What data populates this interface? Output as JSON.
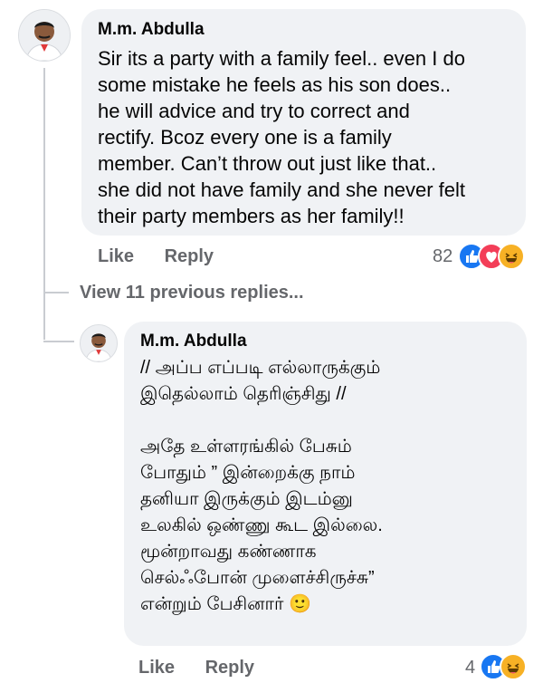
{
  "comments": [
    {
      "author": "M.m. Abdulla",
      "text": "Sir its a party with a family feel.. even I do\nsome mistake he feels  as his son does..\nhe will advice and try to correct and\nrectify. Bcoz every one is a family\nmember. Can’t throw out just like that..\nshe did not have family and she never felt\ntheir party members as her family!!",
      "like_label": "Like",
      "reply_label": "Reply",
      "reaction_count": "82",
      "reactions": [
        "like-icon",
        "love-icon",
        "haha-icon"
      ]
    },
    {
      "author": "M.m. Abdulla",
      "text": "// அப்ப எப்படி எல்லாருக்கும்\nஇதெல்லாம் தெரிஞ்சிது //\n\nஅதே உள்ளரங்கில் பேசும்\nபோதும் ” இன்றைக்கு நாம்\nதனியா இருக்கும் இடம்னு\nஉலகில் ஒண்ணு கூட இல்லை.\nமூன்றாவது கண்ணாக\nசெல்ஃபோன் முளைச்சிருச்சு”\nஎன்றும் பேசினார் 🙂",
      "like_label": "Like",
      "reply_label": "Reply",
      "reaction_count": "4",
      "reactions": [
        "like-icon",
        "haha-icon"
      ]
    }
  ],
  "view_replies_label": "View 11 previous replies...",
  "colors": {
    "bubble": "#f0f2f5",
    "secondary_text": "#65676b",
    "like_blue": "#1877f2",
    "love_red": "#f33e58",
    "haha_yellow": "#f7b125"
  }
}
